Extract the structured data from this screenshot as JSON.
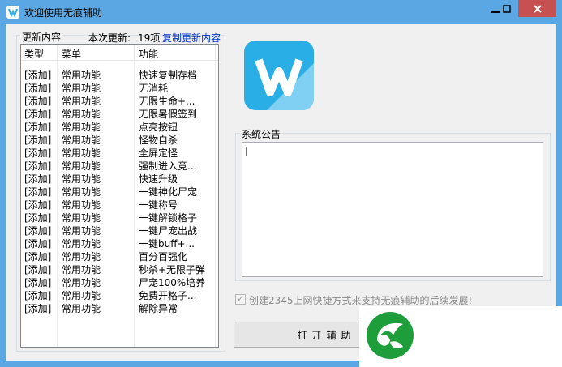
{
  "window": {
    "title": "欢迎使用无痕辅助",
    "controls": {
      "minimize": "─",
      "maximize": "□",
      "close": "✕"
    }
  },
  "updates": {
    "group_label": "更新内容",
    "count_label": "本次更新:",
    "count_value": "19项",
    "copy_link": "复制更新内容",
    "columns": [
      "类型",
      "菜单",
      "功能"
    ],
    "rows": [
      {
        "type": "[添加]",
        "menu": "常用功能",
        "feature": "快速复制存档"
      },
      {
        "type": "[添加]",
        "menu": "常用功能",
        "feature": "无消耗"
      },
      {
        "type": "[添加]",
        "menu": "常用功能",
        "feature": "无限生命+..."
      },
      {
        "type": "[添加]",
        "menu": "常用功能",
        "feature": "无限暑假签到"
      },
      {
        "type": "[添加]",
        "menu": "常用功能",
        "feature": "点亮按钮"
      },
      {
        "type": "[添加]",
        "menu": "常用功能",
        "feature": "怪物自杀"
      },
      {
        "type": "[添加]",
        "menu": "常用功能",
        "feature": "全屏定怪"
      },
      {
        "type": "[添加]",
        "menu": "常用功能",
        "feature": "强制进入竞..."
      },
      {
        "type": "[添加]",
        "menu": "常用功能",
        "feature": "快速升级"
      },
      {
        "type": "[添加]",
        "menu": "常用功能",
        "feature": "一键神化尸宠"
      },
      {
        "type": "[添加]",
        "menu": "常用功能",
        "feature": "一键称号"
      },
      {
        "type": "[添加]",
        "menu": "常用功能",
        "feature": "一键解锁格子"
      },
      {
        "type": "[添加]",
        "menu": "常用功能",
        "feature": "一键尸宠出战"
      },
      {
        "type": "[添加]",
        "menu": "常用功能",
        "feature": "一键buff+..."
      },
      {
        "type": "[添加]",
        "menu": "常用功能",
        "feature": "百分百强化"
      },
      {
        "type": "[添加]",
        "menu": "常用功能",
        "feature": "秒杀+无限子弹"
      },
      {
        "type": "[添加]",
        "menu": "常用功能",
        "feature": "尸宠100%培养"
      },
      {
        "type": "[添加]",
        "menu": "常用功能",
        "feature": "免费开格子..."
      },
      {
        "type": "[添加]",
        "menu": "常用功能",
        "feature": "解除异常"
      }
    ]
  },
  "announcement": {
    "label": "系统公告",
    "text": ""
  },
  "shortcut_option": {
    "label": "创建2345上网快捷方式来支持无痕辅助的后续发展!",
    "checked": true
  },
  "open_button": {
    "label": "打开辅助"
  },
  "colors": {
    "titlebar": "#5aa7e4",
    "logo_bg": "#2aaee6",
    "close_button": "#c75050",
    "link": "#0033cc",
    "overlay_logo": "#1e9e3a"
  }
}
